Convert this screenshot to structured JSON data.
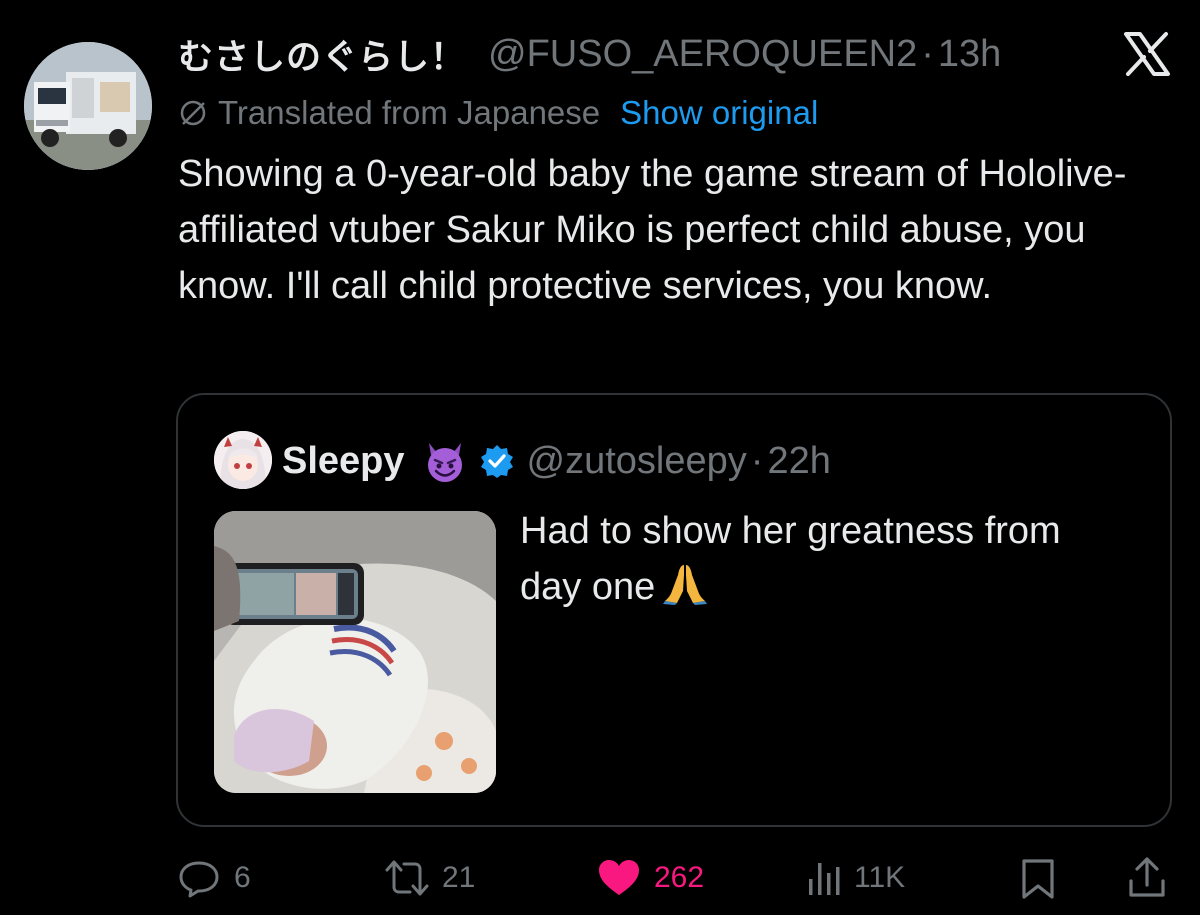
{
  "colors": {
    "background": "#000000",
    "text_primary": "#e7e9ea",
    "text_secondary": "#71767b",
    "link": "#1d9bf0",
    "like": "#f91880",
    "verified": "#1d9bf0",
    "border": "#2f3336"
  },
  "post": {
    "display_name": "むさしのぐらし！",
    "handle": "@FUSO_AEROQUEEN2",
    "separator": "·",
    "time": "13h",
    "translated_label": "Translated from Japanese",
    "show_original": "Show original",
    "text": "Showing a 0-year-old baby the game stream of Hololive-affiliated vtuber Sakur Miko is perfect child abuse, you know. I'll call child protective services, you know.",
    "avatar_icon": "truck-avatar",
    "brand_icon": "x-logo-icon"
  },
  "quote": {
    "display_name": "Sleepy",
    "name_emoji": "smiling-devil-emoji",
    "verified_icon": "verified-badge-icon",
    "handle": "@zutosleepy",
    "separator": "·",
    "time": "22h",
    "text": "Had to show her greatness from day one",
    "text_emoji": "folded-hands-emoji",
    "image_icon": "newborn-baby-phone-photo"
  },
  "actions": {
    "replies": "6",
    "reposts": "21",
    "likes": "262",
    "liked": true,
    "views": "11K",
    "icons": [
      "reply-icon",
      "repost-icon",
      "heart-icon",
      "views-icon",
      "bookmark-icon",
      "share-icon"
    ]
  }
}
